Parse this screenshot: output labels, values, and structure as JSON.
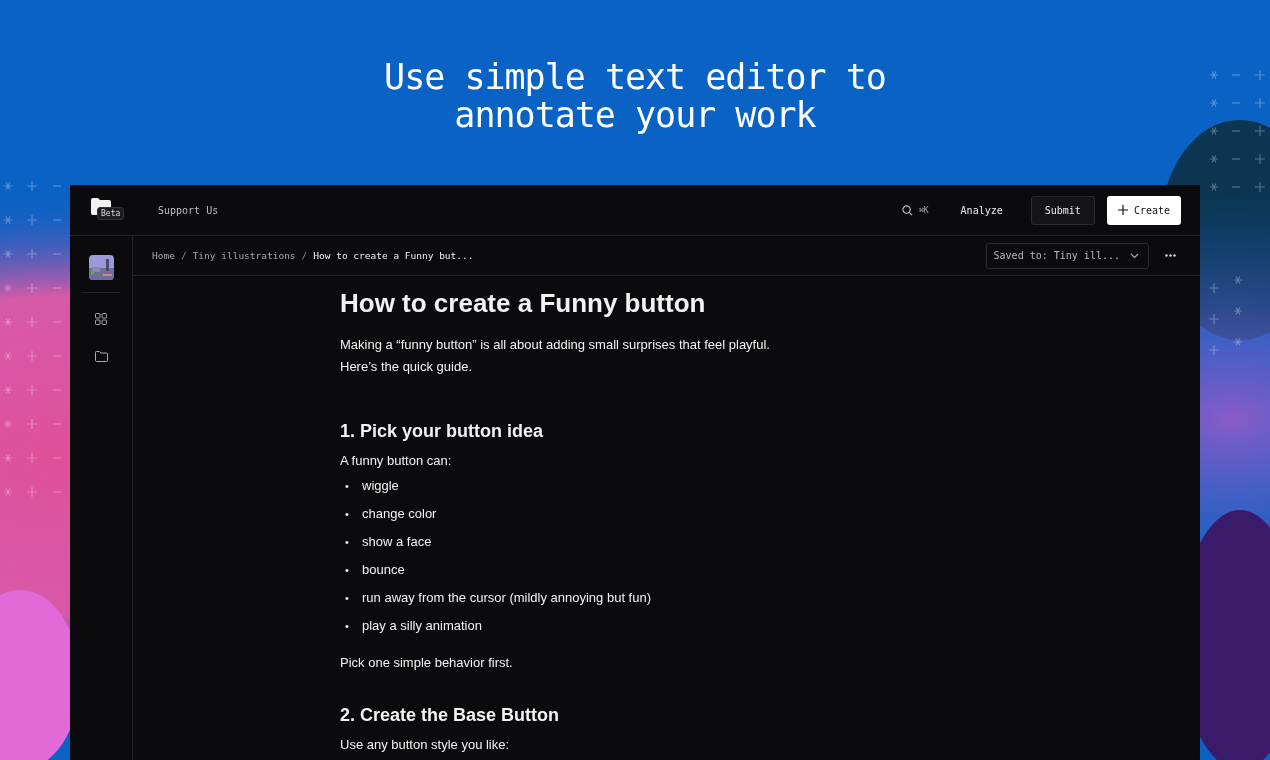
{
  "headline": "Use simple text editor to\nannotate your work",
  "topbar": {
    "badge": "Beta",
    "nav_link": "Support Us",
    "shortcut": "⌘K",
    "analyze": "Analyze",
    "submit": "Submit",
    "create": "Create"
  },
  "breadcrumb": {
    "items": [
      "Home",
      "Tiny illustrations"
    ],
    "separator": "/",
    "current": "How to create a Funny but..."
  },
  "saved_to": "Saved to: Tiny ill...",
  "document": {
    "title": "How to create a Funny button",
    "intro": "Making a “funny button” is all about adding small surprises that feel playful.\nHere’s the quick guide.",
    "sections": [
      {
        "heading": "1. Pick your button idea",
        "lead": "A funny button can:",
        "bullet_marker": "•",
        "bullets": [
          "wiggle",
          "change color",
          "show a face",
          "bounce",
          "run away from the cursor (mildly annoying but fun)",
          "play a silly animation"
        ],
        "closing": "Pick one simple behavior first."
      },
      {
        "heading": "2. Create the Base Button",
        "lead": "Use any button style you like:"
      }
    ]
  }
}
